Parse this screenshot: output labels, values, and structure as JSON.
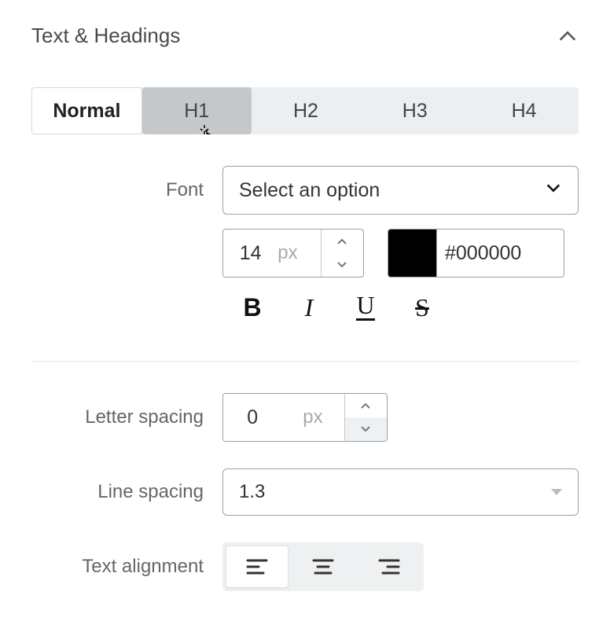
{
  "header": {
    "title": "Text & Headings"
  },
  "tabs": [
    "Normal",
    "H1",
    "H2",
    "H3",
    "H4"
  ],
  "active_tab_index": 0,
  "hover_tab_index": 1,
  "font": {
    "label": "Font",
    "placeholder": "Select an option",
    "size_value": "14",
    "size_unit": "px",
    "color_hex": "#000000",
    "swatch_color": "#000000"
  },
  "format": {
    "bold": "B",
    "italic": "I",
    "underline": "U",
    "strike": "S"
  },
  "letter_spacing": {
    "label": "Letter spacing",
    "value": "0",
    "unit": "px"
  },
  "line_spacing": {
    "label": "Line spacing",
    "value": "1.3"
  },
  "text_alignment": {
    "label": "Text alignment",
    "options": [
      "left",
      "center",
      "right"
    ],
    "active_index": 0
  }
}
